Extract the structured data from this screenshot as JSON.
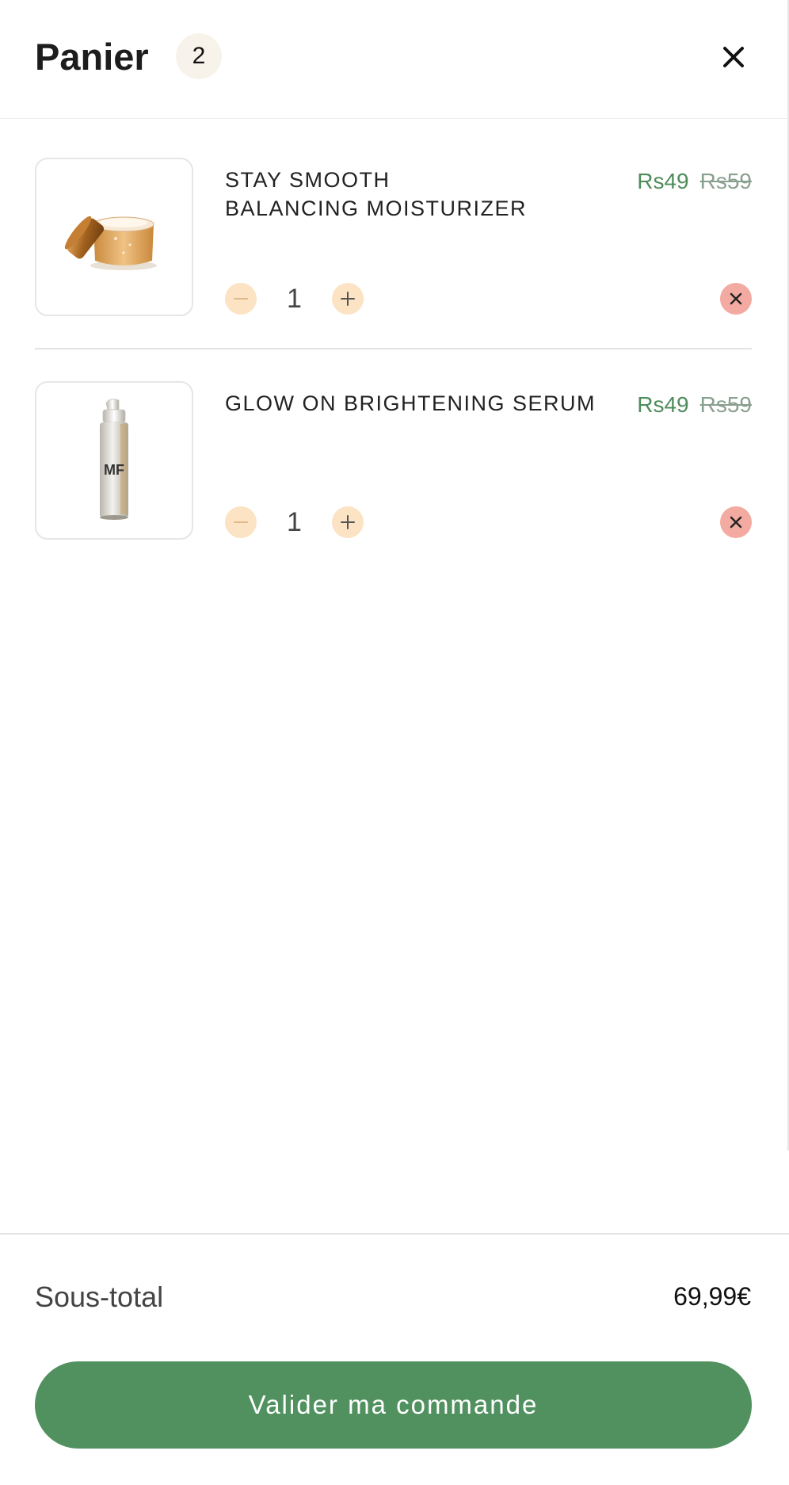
{
  "header": {
    "title": "Panier",
    "item_count": "2",
    "close_icon": "close-icon"
  },
  "items": [
    {
      "name_line1": "STAY SMOOTH",
      "name_line2": "BALANCING MOISTURIZER",
      "price": "Rs49",
      "compare_price": "Rs59",
      "quantity": "1",
      "image": "moisturizer-jar-image"
    },
    {
      "name_line1": "GLOW ON BRIGHTENING SERUM",
      "name_line2": "",
      "price": "Rs49",
      "compare_price": "Rs59",
      "quantity": "1",
      "image": "serum-bottle-image",
      "bottle_label": "MF"
    }
  ],
  "footer": {
    "subtotal_label": "Sous-total",
    "subtotal_value": "69,99€",
    "checkout_label": "Valider ma commande"
  },
  "colors": {
    "accent_green": "#519160",
    "price_green": "#4e8c5a",
    "quantity_button": "#fbe3c4",
    "remove_button": "#f2aaa1",
    "badge_bg": "#f7f3ea"
  }
}
